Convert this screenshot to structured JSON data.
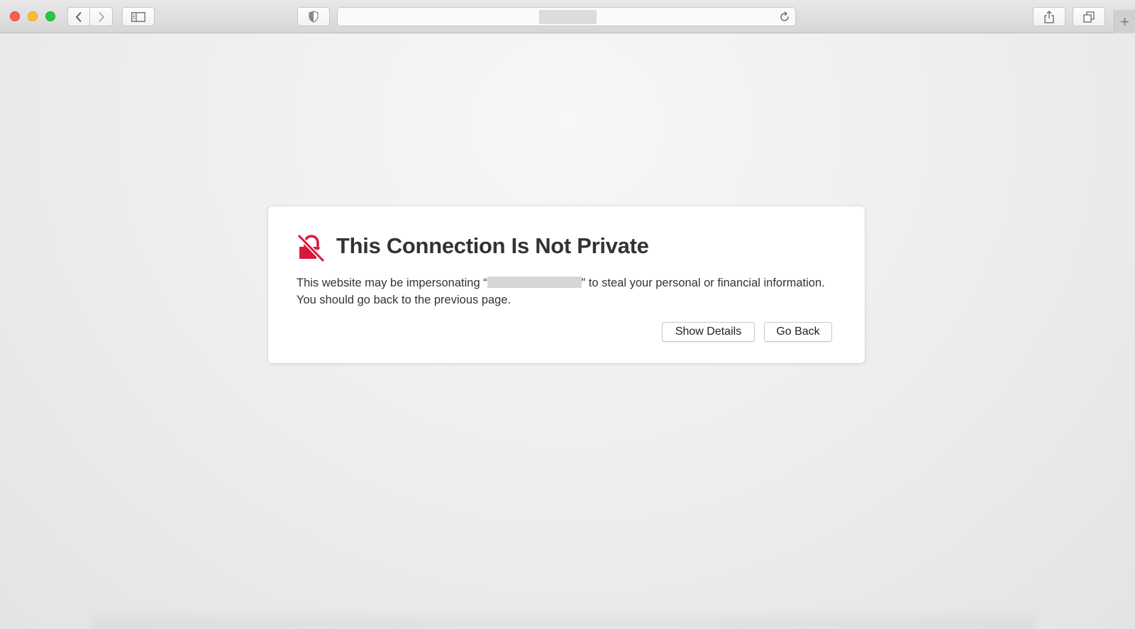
{
  "browser": {
    "toolbar": {
      "back_icon": "chevron-left-icon",
      "forward_icon": "chevron-right-icon",
      "sidebar_icon": "sidebar-icon",
      "privacy_icon": "shield-icon",
      "reload_icon": "reload-icon",
      "share_icon": "share-icon",
      "tabs_icon": "tab-overview-icon",
      "new_tab_label": "+"
    },
    "address_bar": {
      "url_redacted": true
    }
  },
  "warning": {
    "icon": "broken-lock-icon",
    "icon_color": "#d9173c",
    "title": "This Connection Is Not Private",
    "body_before": "This website may be impersonating “",
    "body_host_redacted": true,
    "body_after": "” to steal your personal or financial information. You should go back to the previous page.",
    "buttons": {
      "show_details": "Show Details",
      "go_back": "Go Back"
    }
  }
}
